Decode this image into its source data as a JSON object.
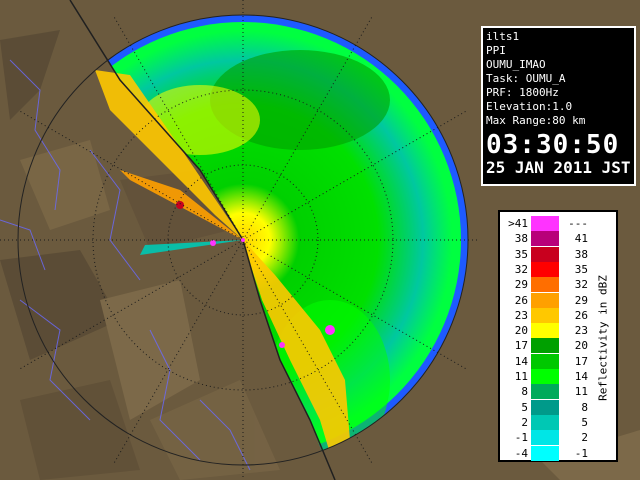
{
  "info": {
    "lines": [
      "ilts1",
      "PPI",
      "OUMU_IMAO",
      "Task: OUMU_A",
      "PRF: 1800Hz",
      "Elevation:1.0",
      "Max Range:80 km"
    ],
    "time": "03:30:50",
    "date": "25 JAN 2011 JST"
  },
  "legend": {
    "title": "Reflectivity in dBZ",
    "rows": [
      {
        "lo": ">41",
        "hi": "---",
        "color": "#ff33ff"
      },
      {
        "lo": "38",
        "hi": "41",
        "color": "#b8007a"
      },
      {
        "lo": "35",
        "hi": "38",
        "color": "#c8001e"
      },
      {
        "lo": "32",
        "hi": "35",
        "color": "#ff0000"
      },
      {
        "lo": "29",
        "hi": "32",
        "color": "#ff6e00"
      },
      {
        "lo": "26",
        "hi": "29",
        "color": "#ffa000"
      },
      {
        "lo": "23",
        "hi": "26",
        "color": "#ffc800"
      },
      {
        "lo": "20",
        "hi": "23",
        "color": "#ffff00"
      },
      {
        "lo": "17",
        "hi": "20",
        "color": "#00a000"
      },
      {
        "lo": "14",
        "hi": "17",
        "color": "#00c800"
      },
      {
        "lo": "11",
        "hi": "14",
        "color": "#00ff00"
      },
      {
        "lo": "8",
        "hi": "11",
        "color": "#00aa5a"
      },
      {
        "lo": "5",
        "hi": "8",
        "color": "#009a8a"
      },
      {
        "lo": "2",
        "hi": "5",
        "color": "#00c8b4"
      },
      {
        "lo": "-1",
        "hi": "2",
        "color": "#00e6e6"
      },
      {
        "lo": "-4",
        "hi": "-1",
        "color": "#00ffff"
      }
    ]
  }
}
